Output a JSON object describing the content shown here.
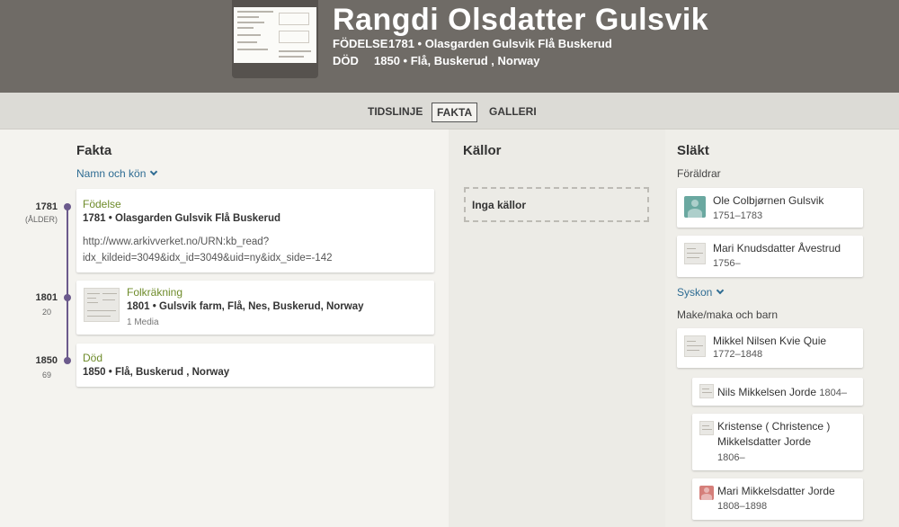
{
  "person": {
    "name": "Rangdi Olsdatter Gulsvik",
    "birth_label": "FÖDELSE",
    "birth_value": "1781 • Olasgarden Gulsvik Flå Buskerud",
    "death_label": "DÖD",
    "death_value": "1850 • Flå, Buskerud , Norway"
  },
  "tabs": [
    "TIDSLINJE",
    "FAKTA",
    "GALLERI"
  ],
  "active_tab": "FAKTA",
  "facts": {
    "title": "Fakta",
    "filter_label": "Namn och kön",
    "events": [
      {
        "year": "1781",
        "age": "(ÅLDER)",
        "type": "Födelse",
        "value": "1781 • Olasgarden Gulsvik Flå Buskerud",
        "note_line1": "http://www.arkivverket.no/URN:kb_read?",
        "note_line2": "idx_kildeid=3049&idx_id=3049&uid=ny&idx_side=-142"
      },
      {
        "year": "1801",
        "age": "20",
        "type": "Folkräkning",
        "value": "1801 • Gulsvik farm, Flå, Nes, Buskerud, Norway",
        "media": "1 Media"
      },
      {
        "year": "1850",
        "age": "69",
        "type": "Död",
        "value": "1850 • Flå, Buskerud , Norway"
      }
    ]
  },
  "sources": {
    "title": "Källor",
    "empty_label": "Inga källor"
  },
  "relatives": {
    "title": "Släkt",
    "parents_label": "Föräldrar",
    "parents": [
      {
        "name": "Ole Colbjørnen Gulsvik",
        "dates": "1751–1783",
        "avatar": "male-silhouette-icon"
      },
      {
        "name": "Mari Knudsdatter Åvestrud",
        "dates": "1756–",
        "avatar": "document-thumbnail"
      }
    ],
    "siblings_label": "Syskon",
    "spouse_label": "Make/maka och barn",
    "spouse": {
      "name": "Mikkel Nilsen Kvie Quie",
      "dates": "1772–1848",
      "avatar": "document-thumbnail"
    },
    "children": [
      {
        "name": "Nils Mikkelsen Jorde",
        "dates": "1804–",
        "avatar": "document-thumbnail"
      },
      {
        "name_line1": "Kristense ( Christence )",
        "name_line2": "Mikkelsdatter Jorde",
        "dates": "1806–",
        "avatar": "document-thumbnail"
      },
      {
        "name": "Mari Mikkelsdatter Jorde",
        "dates": "1808–1898",
        "avatar": "female-silhouette-icon"
      }
    ]
  },
  "colors": {
    "header_bg": "#6f6b66",
    "tabbar_bg": "#dcdbd6",
    "timeline": "#6b5a8c",
    "event_type": "#6e8b2a",
    "link": "#2e6c93",
    "male_avatar": "#6aa8a0",
    "female_avatar": "#d57f7a"
  }
}
